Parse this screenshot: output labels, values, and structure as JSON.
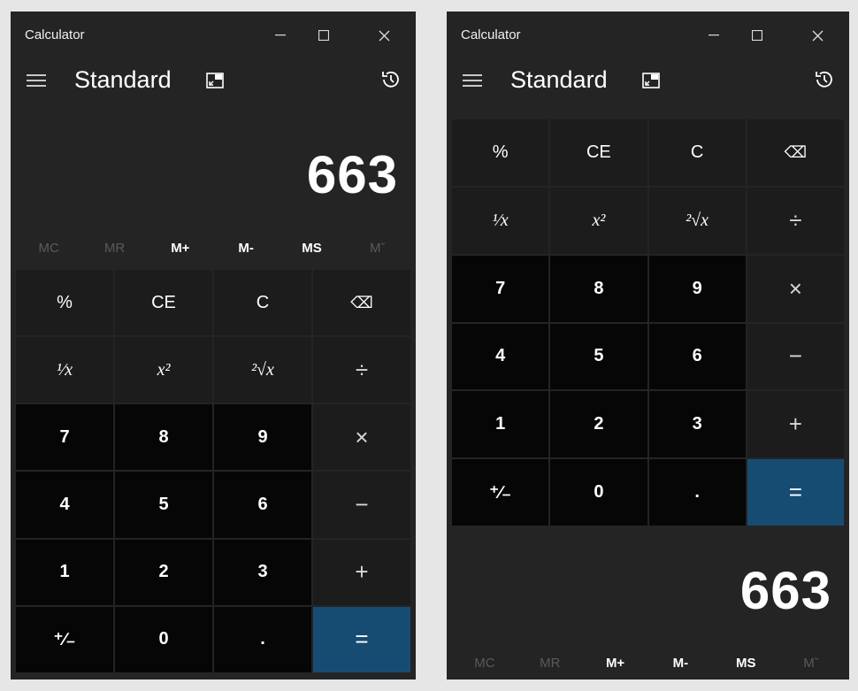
{
  "app": {
    "title": "Calculator",
    "mode": "Standard"
  },
  "display": {
    "value": "663"
  },
  "memory": [
    "MC",
    "MR",
    "M+",
    "M-",
    "MS",
    "Mˇ"
  ],
  "memory_disabled": [
    true,
    true,
    false,
    false,
    false,
    true
  ],
  "keys": [
    {
      "label": "%",
      "kind": "op"
    },
    {
      "label": "CE",
      "kind": "op"
    },
    {
      "label": "C",
      "kind": "op"
    },
    {
      "label": "⌫",
      "kind": "op",
      "name": "backspace"
    },
    {
      "label": "¹⁄x",
      "kind": "op",
      "name": "reciprocal"
    },
    {
      "label": "x²",
      "kind": "op",
      "name": "square"
    },
    {
      "label": "²√x",
      "kind": "op",
      "name": "square-root"
    },
    {
      "label": "÷",
      "kind": "op",
      "name": "divide"
    },
    {
      "label": "7",
      "kind": "num"
    },
    {
      "label": "8",
      "kind": "num"
    },
    {
      "label": "9",
      "kind": "num"
    },
    {
      "label": "×",
      "kind": "op",
      "name": "multiply"
    },
    {
      "label": "4",
      "kind": "num"
    },
    {
      "label": "5",
      "kind": "num"
    },
    {
      "label": "6",
      "kind": "num"
    },
    {
      "label": "−",
      "kind": "op",
      "name": "subtract"
    },
    {
      "label": "1",
      "kind": "num"
    },
    {
      "label": "2",
      "kind": "num"
    },
    {
      "label": "3",
      "kind": "num"
    },
    {
      "label": "+",
      "kind": "op",
      "name": "add"
    },
    {
      "label": "⁺∕₋",
      "kind": "num",
      "name": "negate"
    },
    {
      "label": "0",
      "kind": "num"
    },
    {
      "label": ".",
      "kind": "num",
      "name": "decimal"
    },
    {
      "label": "=",
      "kind": "eq",
      "name": "equals"
    }
  ],
  "icons": {
    "menu": "hamburger-icon",
    "keep_on_top": "keep-on-top-icon",
    "history": "history-icon",
    "minimize": "minimize-icon",
    "maximize": "maximize-icon",
    "close": "close-icon"
  },
  "colors": {
    "window_bg": "#242424",
    "op_key": "#1c1c1c",
    "num_key": "#060606",
    "equals_key": "#174c72",
    "memory_disabled": "#5a5a5a"
  }
}
